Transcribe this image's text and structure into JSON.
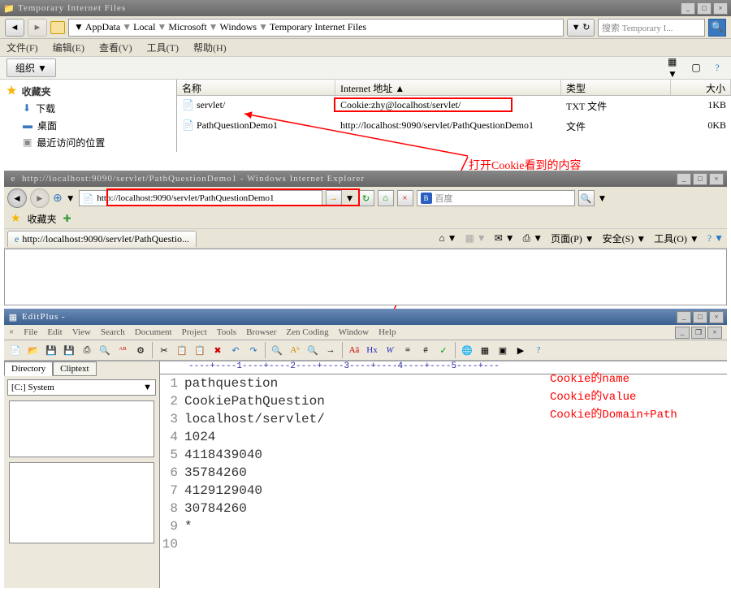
{
  "explorer": {
    "title": "Temporary Internet Files",
    "breadcrumb": [
      "AppData",
      "Local",
      "Microsoft",
      "Windows",
      "Temporary Internet Files"
    ],
    "search_placeholder": "搜索 Temporary I...",
    "menus": [
      "文件(F)",
      "编辑(E)",
      "查看(V)",
      "工具(T)",
      "帮助(H)"
    ],
    "organize": "组织 ▼",
    "sidebar": {
      "favorites": "收藏夹",
      "items": [
        "下载",
        "桌面",
        "最近访问的位置"
      ]
    },
    "columns": {
      "name": "名称",
      "addr": "Internet 地址 ▲",
      "type": "类型",
      "size": "大小"
    },
    "rows": [
      {
        "name": "servlet/",
        "addr": "Cookie:zhy@localhost/servlet/",
        "type": "TXT 文件",
        "size": "1KB"
      },
      {
        "name": "PathQuestionDemo1",
        "addr": "http://localhost:9090/servlet/PathQuestionDemo1",
        "type": "文件",
        "size": "0KB"
      }
    ]
  },
  "annotation1": "打开Cookie看到的内容",
  "ie": {
    "title": "http://localhost:9090/servlet/PathQuestionDemo1 - Windows Internet Explorer",
    "url": "http://localhost:9090/servlet/PathQuestionDemo1",
    "search": "百度",
    "favorites_label": "收藏夹",
    "tab_title": "http://localhost:9090/servlet/PathQuestio...",
    "tools": [
      "页面(P)",
      "安全(S)",
      "工具(O)"
    ]
  },
  "editplus": {
    "title": "EditPlus -",
    "menus": [
      "File",
      "Edit",
      "View",
      "Search",
      "Document",
      "Project",
      "Tools",
      "Browser",
      "Zen Coding",
      "Window",
      "Help"
    ],
    "side_tabs": [
      "Directory",
      "Cliptext"
    ],
    "drive": "[C:] System",
    "ruler": "----+----1----+----2----+----3----+----4----+----5----+---",
    "lines": [
      "pathquestion",
      "CookiePathQuestion",
      "localhost/servlet/",
      "1024",
      "4118439040",
      "35784260",
      "4129129040",
      "30784260",
      "*",
      ""
    ],
    "annotations": [
      "Cookie的name",
      "Cookie的value",
      "Cookie的Domain+Path"
    ]
  }
}
